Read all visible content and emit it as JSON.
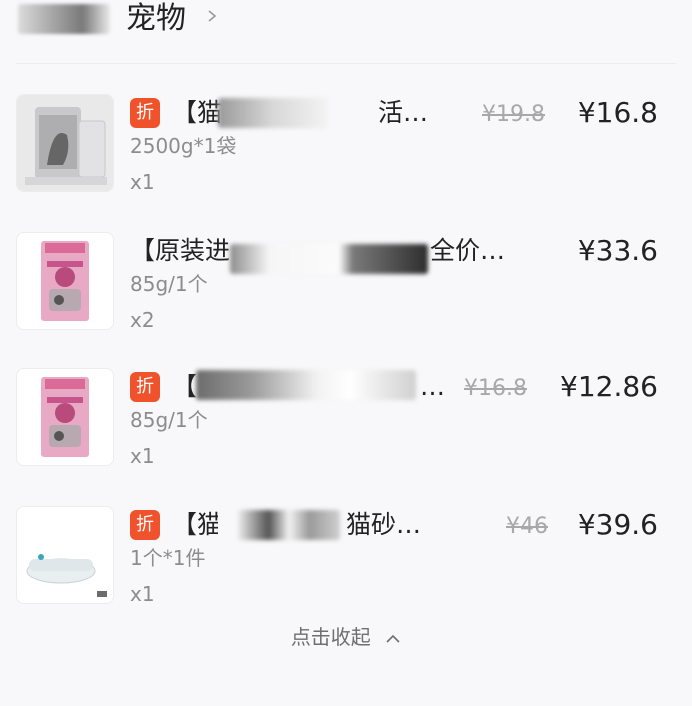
{
  "header": {
    "title": "宠物",
    "chevron_icon": "chevron-right-icon"
  },
  "items": [
    {
      "badge": "折",
      "name": "【猫",
      "name_tail": "活…",
      "original_price": "¥19.8",
      "price": "¥16.8",
      "spec": "2500g*1袋",
      "qty": "x1",
      "image": "cat-litter-bag-icon"
    },
    {
      "badge": "",
      "name": "【原装进",
      "name_tail": "全价…",
      "original_price": "",
      "price": "¥33.6",
      "spec": "85g/1个",
      "qty": "x2",
      "image": "royal-canin-pouch-icon"
    },
    {
      "badge": "折",
      "name": "【",
      "name_tail": "…",
      "original_price": "¥16.8",
      "price": "¥12.86",
      "spec": "85g/1个",
      "qty": "x1",
      "image": "royal-canin-pouch-icon"
    },
    {
      "badge": "折",
      "name": "【猫",
      "name_tail": "猫砂…",
      "original_price": "¥46",
      "price": "¥39.6",
      "spec": "1个*1件",
      "qty": "x1",
      "image": "litter-box-icon"
    }
  ],
  "footer": {
    "collapse_label": "点击收起",
    "arrow_icon": "chevron-up-icon"
  },
  "colors": {
    "badge": "#f0522c",
    "price": "#222222",
    "muted": "#8c8c8c"
  }
}
